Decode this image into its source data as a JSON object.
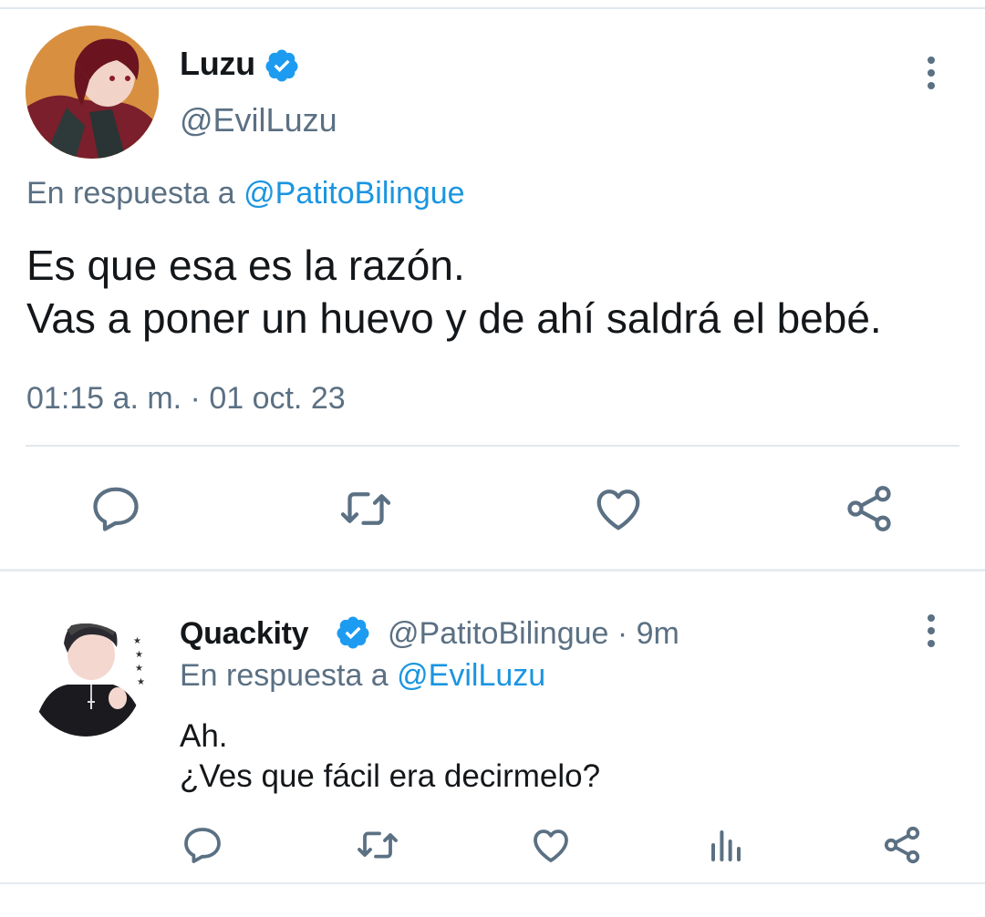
{
  "main_tweet": {
    "author_name": "Luzu",
    "handle": "@EvilLuzu",
    "reply_prefix": "En respuesta a",
    "reply_to": "@PatitoBilingue",
    "text_line1": "Es que esa es la razón.",
    "text_line2": "Vas a poner un huevo y de ahí saldrá el bebé.",
    "timestamp": "01:15 a. m. · 01 oct. 23",
    "actions": [
      "reply-icon",
      "retweet-icon",
      "like-icon",
      "share-icon"
    ]
  },
  "reply_tweet": {
    "author_name": "Quackity",
    "handle_time": "@PatitoBilingue · 9m",
    "reply_prefix": "En respuesta a",
    "reply_to": "@EvilLuzu",
    "text_line1": "Ah.",
    "text_line2": "¿Ves que fácil era decirmelo?",
    "actions": [
      "reply-icon",
      "retweet-icon",
      "like-icon",
      "analytics-icon",
      "share-icon"
    ]
  },
  "colors": {
    "verified": "#1d9bf0",
    "secondary_text": "#5b7083",
    "link": "#1b95e0",
    "icon": "#5b7083",
    "divider": "#e1e8ed"
  }
}
